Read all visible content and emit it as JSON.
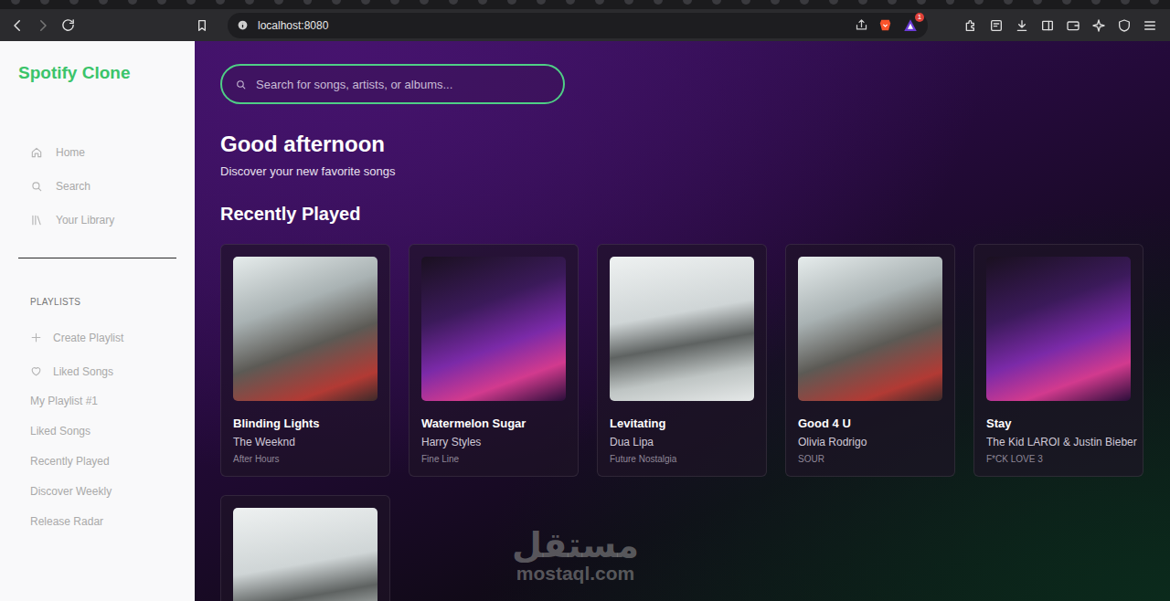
{
  "browser": {
    "url": "localhost:8080",
    "badge": "1"
  },
  "sidebar": {
    "logo": "Spotify Clone",
    "nav": [
      {
        "label": "Home",
        "selected": false
      },
      {
        "label": "Search",
        "selected": false
      },
      {
        "label": "Your Library",
        "selected": false
      }
    ],
    "section_title": "PLAYLISTS",
    "actions": [
      {
        "label": "Create Playlist",
        "kind": "plus"
      },
      {
        "label": "Liked Songs",
        "kind": "heart"
      }
    ],
    "playlists": [
      "My Playlist #1",
      "Liked Songs",
      "Recently Played",
      "Discover Weekly",
      "Release Radar"
    ]
  },
  "search": {
    "placeholder": "Search for songs, artists, or albums...",
    "focused": true
  },
  "greeting": "Good afternoon",
  "subtitle": "Discover your new favorite songs",
  "section_title": "Recently Played",
  "cards": [
    {
      "title": "Blinding Lights",
      "artist": "The Weeknd",
      "album": "After Hours"
    },
    {
      "title": "Watermelon Sugar",
      "artist": "Harry Styles",
      "album": "Fine Line"
    },
    {
      "title": "Levitating",
      "artist": "Dua Lipa",
      "album": "Future Nostalgia"
    },
    {
      "title": "Good 4 U",
      "artist": "Olivia Rodrigo",
      "album": "SOUR"
    },
    {
      "title": "Stay",
      "artist": "The Kid LAROI & Justin Bieber",
      "album": "F*CK LOVE 3"
    },
    {
      "title": "",
      "artist": "",
      "album": ""
    }
  ],
  "watermark": {
    "arabic": "مستقل",
    "latin": "mostaql.com"
  }
}
